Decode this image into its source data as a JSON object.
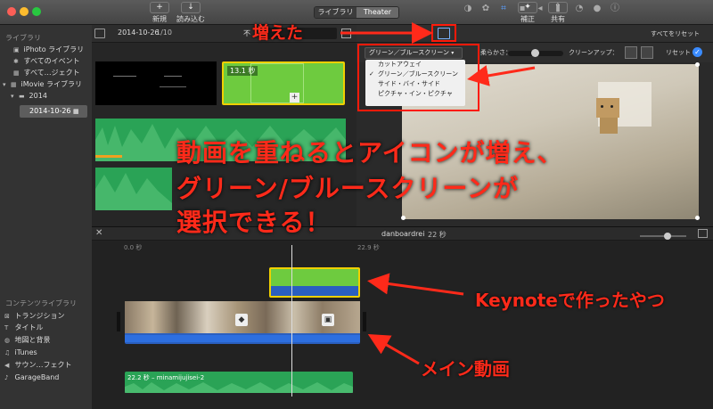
{
  "window": {
    "traffic": [
      "close",
      "minimize",
      "zoom"
    ]
  },
  "toolbar": {
    "new_label": "新規",
    "import_label": "読み込む",
    "new_icon": "plus-icon",
    "import_icon": "down-arrow-icon",
    "seg_library": "ライブラリ",
    "seg_theater": "Theater",
    "enhance_label": "補正",
    "share_label": "共有"
  },
  "sidebar": {
    "header": "ライブラリ",
    "items": [
      {
        "icon": "photo-icon",
        "label": "iPhoto ライブラリ"
      },
      {
        "icon": "star-icon",
        "label": "すべてのイベント"
      },
      {
        "icon": "film-icon",
        "label": "すべて…ジェクト"
      },
      {
        "icon": "library-icon",
        "label": "iMovie ライブラリ"
      },
      {
        "icon": "folder-icon",
        "label": "2014"
      },
      {
        "icon": "event-icon",
        "label": "2014-10-26"
      }
    ],
    "content_header": "コンテンツライブラリ",
    "content_items": [
      {
        "icon": "transition-icon",
        "label": "トランジション"
      },
      {
        "icon": "title-icon",
        "label": "タイトル"
      },
      {
        "icon": "globe-icon",
        "label": "地図と背景"
      },
      {
        "icon": "music-icon",
        "label": "iTunes"
      },
      {
        "icon": "speaker-icon",
        "label": "サウン…フェクト"
      },
      {
        "icon": "guitar-icon",
        "label": "GarageBand"
      }
    ]
  },
  "browser": {
    "event": "2014-10-26",
    "count": "1/10",
    "filter_partial": "不",
    "clip_duration": "13.1 秒"
  },
  "viewer": {
    "reset_all": "すべてをリセット",
    "mode_select": "グリーン／ブルースクリーン",
    "softness_label": "柔らかさ：",
    "cleanup_label": "クリーンアップ：",
    "reset": "リセット",
    "menu": [
      "カットアウェイ",
      "グリーン／ブルースクリーン",
      "サイド・バイ・サイド",
      "ピクチャ・イン・ピクチャ"
    ],
    "menu_checked": 1
  },
  "timeline": {
    "project": "danboardrei",
    "duration": "22 秒",
    "time_start": "0.0 秒",
    "time_end": "22.9 秒",
    "audio_label": "22.2 秒 – minamijujisei-2"
  },
  "annotations": {
    "icons_added": "増えた",
    "main_caption": [
      "動画を重ねるとアイコンが増え、",
      "グリーン/ブルースクリーンが",
      "選択できる！"
    ],
    "keynote": "Keynoteで作ったやつ",
    "main_video": "メイン動画"
  },
  "colors": {
    "annotation": "#ff2a1a",
    "green_clip": "#6ecb3f",
    "blue_track": "#2a5fc0",
    "audio": "#2aa356",
    "selection": "#f0d000"
  }
}
